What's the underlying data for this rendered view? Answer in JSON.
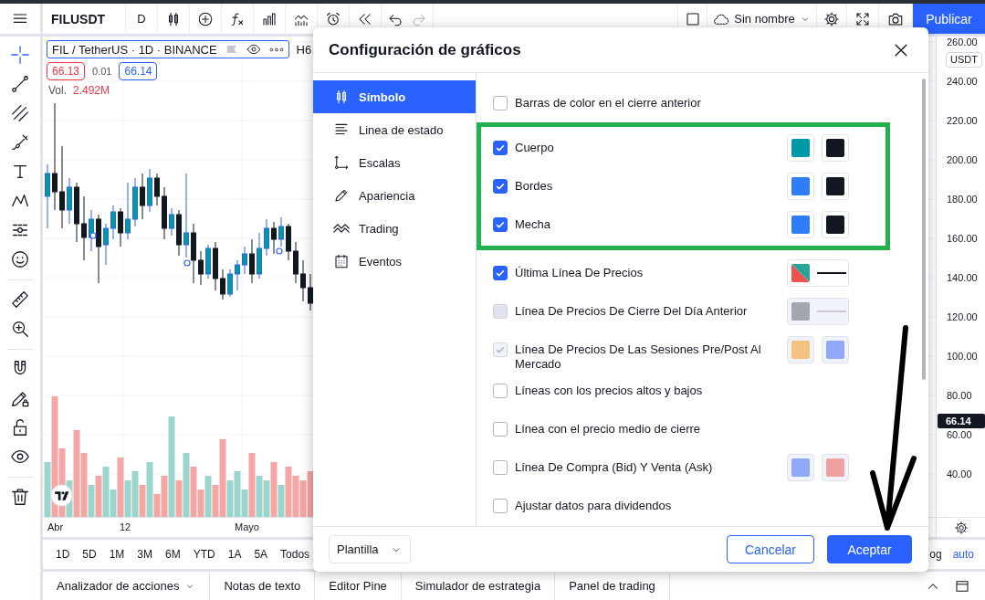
{
  "top_toolbar": {
    "symbol": "FILUSDT",
    "interval": "D",
    "layout_name": "Sin nombre",
    "publish_button": "Publicar"
  },
  "left_toolbar": [
    {
      "selected": true
    },
    {
      "selected": false
    },
    {
      "selected": false
    },
    {
      "selected": false
    },
    {
      "selected": false
    },
    {
      "selected": false
    },
    {
      "selected": false
    },
    {
      "selected": false
    },
    {
      "selected": false
    },
    {
      "selected": false
    },
    {
      "selected": false
    },
    {
      "selected": false
    },
    {
      "selected": false
    },
    {
      "selected": false
    },
    {
      "selected": false
    }
  ],
  "chart": {
    "legend": {
      "title": "FIL / TetherUS · 1D · BINANCE",
      "cut_value": "H6",
      "sell_price": "66.13",
      "spread": "0.01",
      "buy_price": "66.14",
      "volume_label": "Vol.",
      "volume_value": "2.492M"
    },
    "time_axis": [
      "Abr",
      "12",
      "Mayo"
    ],
    "price_axis": {
      "labels": [
        "260.00",
        "240.00",
        "220.00",
        "200.00",
        "180.00",
        "160.00",
        "140.00",
        "120.00",
        "100.00",
        "80.00",
        "60.00",
        "40.00"
      ],
      "currency": "USDT",
      "last_price": "66.14"
    }
  },
  "time_ranges": [
    "1D",
    "5D",
    "1M",
    "3M",
    "6M",
    "YTD",
    "1A",
    "5A",
    "Todos"
  ],
  "scale_modes": [
    {
      "label": "og",
      "selected": false
    },
    {
      "label": "auto",
      "selected": true
    }
  ],
  "bottom_tabs": [
    {
      "label": "Analizador de acciones",
      "kind": "menu"
    },
    {
      "label": "Notas de texto",
      "kind": "tab"
    },
    {
      "label": "Editor Pine",
      "kind": "tab"
    },
    {
      "label": "Simulador de estrategia",
      "kind": "tab"
    },
    {
      "label": "Panel de trading",
      "kind": "tab"
    }
  ],
  "settings_dialog": {
    "title": "Configuración de gráficos",
    "nav": [
      {
        "label": "Símbolo",
        "selected": true
      },
      {
        "label": "Linea de estado",
        "selected": false
      },
      {
        "label": "Escalas",
        "selected": false
      },
      {
        "label": "Apariencia",
        "selected": false
      },
      {
        "label": "Trading",
        "selected": false
      },
      {
        "label": "Eventos",
        "selected": false
      }
    ],
    "sections": [
      {
        "highlighted": false,
        "options": [
          {
            "label": "Barras de color en el cierre anterior",
            "checked": false,
            "disabled": false
          }
        ]
      },
      {
        "highlighted": true,
        "options": [
          {
            "label": "Cuerpo",
            "checked": true,
            "disabled": false,
            "controls": [
              {
                "kind": "swatch",
                "color": "#0097a7"
              },
              {
                "kind": "swatch",
                "color": "#131722"
              }
            ]
          },
          {
            "label": "Bordes",
            "checked": true,
            "disabled": false,
            "controls": [
              {
                "kind": "swatch",
                "color": "#2e7cf6"
              },
              {
                "kind": "swatch",
                "color": "#131722"
              }
            ]
          },
          {
            "label": "Mecha",
            "checked": true,
            "disabled": false,
            "controls": [
              {
                "kind": "swatch",
                "color": "#2e7cf6"
              },
              {
                "kind": "swatch",
                "color": "#131722"
              }
            ]
          }
        ]
      },
      {
        "highlighted": false,
        "options": [
          {
            "label": "Última Línea De Precios",
            "checked": true,
            "disabled": false,
            "controls": [
              {
                "kind": "swatch-line",
                "halves": [
                  {
                    "color": "#ef5350"
                  },
                  {
                    "color": "#26a69a"
                  }
                ]
              }
            ]
          },
          {
            "label": "Línea De Precios De Cierre Del Día Anterior",
            "checked": false,
            "disabled": true,
            "controls": [
              {
                "kind": "swatch-line",
                "halves": [
                  {
                    "color": "#a3a6af"
                  }
                ]
              }
            ]
          },
          {
            "label": "Línea De Precios De Las Sesiones Pre/Post Al Mercado",
            "checked": true,
            "disabled": true,
            "controls": [
              {
                "kind": "swatch",
                "color": "#f5c27f"
              },
              {
                "kind": "swatch",
                "color": "#8fa8fa"
              }
            ]
          },
          {
            "label": "Líneas con los precios altos y bajos",
            "checked": false,
            "disabled": false
          },
          {
            "label": "Línea con el precio medio de cierre",
            "checked": false,
            "disabled": false
          },
          {
            "label": "Línea De Compra (Bid) Y Venta (Ask)",
            "checked": false,
            "disabled": false,
            "controls": [
              {
                "kind": "swatch",
                "color": "#8fa8fa"
              },
              {
                "kind": "swatch",
                "color": "#eda1a3"
              }
            ]
          },
          {
            "label": "Ajustar datos para dividendos",
            "checked": false,
            "disabled": false
          }
        ]
      }
    ],
    "template_select": "Plantilla",
    "buttons": [
      {
        "label": "Cancelar",
        "kind": "secondary",
        "pointed": false
      },
      {
        "label": "Aceptar",
        "kind": "primary",
        "pointed": true
      }
    ]
  }
}
